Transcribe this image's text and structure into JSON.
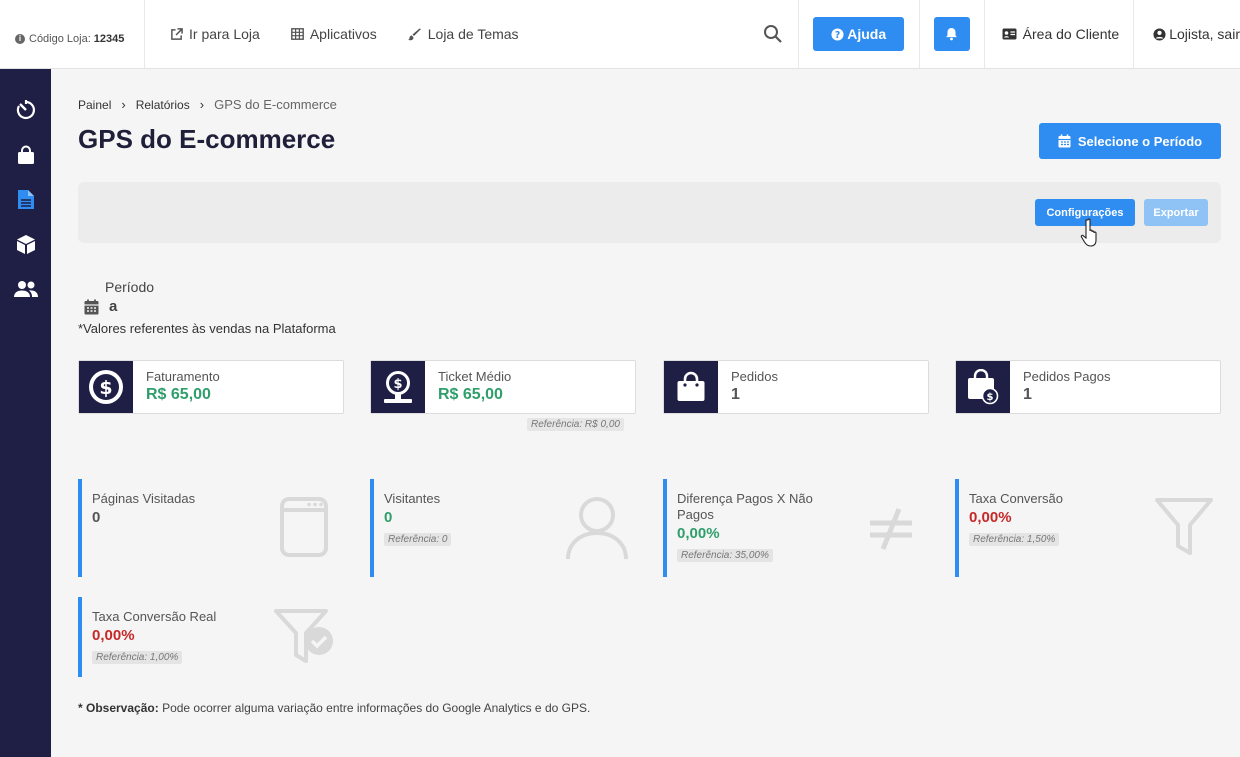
{
  "topbar": {
    "store_label": "Código Loja:",
    "store_code": "12345",
    "links": [
      {
        "label": "Ir para Loja",
        "icon": "external-link-icon"
      },
      {
        "label": "Aplicativos",
        "icon": "grid-icon"
      },
      {
        "label": "Loja de Temas",
        "icon": "brush-icon"
      }
    ],
    "help_label": "Ajuda",
    "client_area_label": "Área do Cliente",
    "user_label": "Lojista, sair"
  },
  "sidebar": {
    "items": [
      {
        "icon": "stopwatch-icon",
        "active": false
      },
      {
        "icon": "shopping-bag-icon",
        "active": false
      },
      {
        "icon": "document-icon",
        "active": true
      },
      {
        "icon": "box-icon",
        "active": false
      },
      {
        "icon": "users-icon",
        "active": false
      }
    ]
  },
  "breadcrumb": {
    "items": [
      "Painel",
      "Relatórios"
    ],
    "current": "GPS do E-commerce"
  },
  "page": {
    "title": "GPS do E-commerce",
    "period_button": "Selecione o Período",
    "config_button": "Configurações",
    "export_button": "Exportar",
    "period_label": "Período",
    "period_value": "a",
    "platform_note": "*Valores referentes às vendas na Plataforma"
  },
  "kpis": [
    {
      "label": "Faturamento",
      "value": "R$ 65,00",
      "icon": "dollar-circle-icon"
    },
    {
      "label": "Ticket Médio",
      "value": "R$ 65,00",
      "icon": "monitor-dollar-icon",
      "reference": "Referência: R$ 0,00"
    },
    {
      "label": "Pedidos",
      "value": "1",
      "icon": "shopping-bag-icon"
    },
    {
      "label": "Pedidos Pagos",
      "value": "1",
      "icon": "paid-bag-icon"
    }
  ],
  "metrics": [
    {
      "label": "Páginas Visitadas",
      "value": "0",
      "icon": "browser-window-icon"
    },
    {
      "label": "Visitantes",
      "value": "0",
      "reference": "Referência: 0",
      "icon": "user-icon"
    },
    {
      "label": "Diferença Pagos X Não Pagos",
      "value": "0,00%",
      "reference": "Referência: 35,00%",
      "icon": "not-equal-icon"
    },
    {
      "label": "Taxa Conversão",
      "value": "0,00%",
      "reference": "Referência: 1,50%",
      "icon": "funnel-icon"
    },
    {
      "label": "Taxa Conversão Real",
      "value": "0,00%",
      "reference": "Referência: 1,00%",
      "icon": "funnel-check-icon"
    }
  ],
  "observation": {
    "prefix": "* Observação:",
    "text": "Pode ocorrer alguma variação entre informações do Google Analytics e do GPS."
  },
  "colors": {
    "primary": "#2f8cf0",
    "sidebar": "#1f1f45",
    "positive": "#2f9e6b",
    "negative": "#c62828"
  }
}
